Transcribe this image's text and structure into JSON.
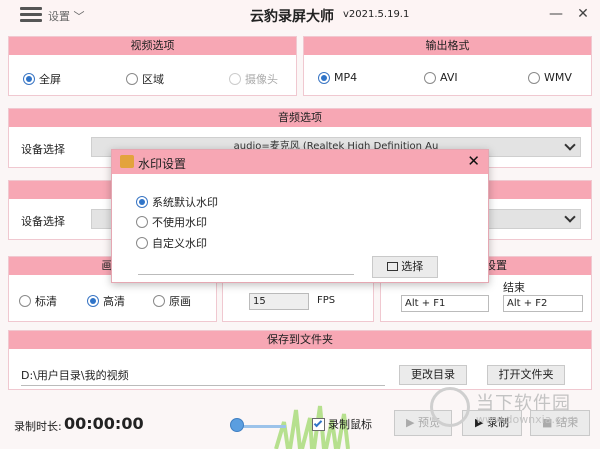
{
  "titlebar": {
    "settings_label": "设置",
    "app_title": "云豹录屏大师",
    "version": "v2021.5.19.1",
    "minimize_glyph": "—",
    "close_glyph": "✕"
  },
  "video_options": {
    "header": "视频选项",
    "fullscreen": "全屏",
    "region": "区域",
    "camera": "摄像头",
    "selected": "全屏"
  },
  "output_format": {
    "header": "输出格式",
    "mp4": "MP4",
    "avi": "AVI",
    "wmv": "WMV",
    "selected": "MP4"
  },
  "audio_options": {
    "header": "音频选项",
    "device_label": "设备选择",
    "device_value": "audio=麦克风 (Realtek High Definition Au"
  },
  "video_device": {
    "device_label": "设备选择"
  },
  "quality": {
    "header": "画质",
    "standard": "标清",
    "high": "高清",
    "original": "原画",
    "selected": "高清"
  },
  "fps": {
    "value": "15",
    "unit": "FPS"
  },
  "hotkeys": {
    "header": "设置",
    "start_value": "Alt + F1",
    "end_label": "结束",
    "end_value": "Alt + F2"
  },
  "save_folder": {
    "header": "保存到文件夹",
    "path": "D:\\用户目录\\我的视频",
    "change_dir": "更改目录",
    "open_folder": "打开文件夹"
  },
  "bottom": {
    "duration_label": "录制时长:",
    "duration_value": "00:00:00",
    "record_mouse": "录制鼠标",
    "preview": "预览",
    "record": "录制",
    "end": "结束"
  },
  "dialog": {
    "title": "水印设置",
    "option_default": "系统默认水印",
    "option_none": "不使用水印",
    "option_custom": "自定义水印",
    "selected": "系统默认水印",
    "select_button": "选择"
  },
  "watermark": {
    "text": "当下软件园",
    "sub": "www.downxia.com"
  },
  "colors": {
    "accent_pink": "#f7a7b4",
    "radio_blue": "#2f74c8"
  }
}
